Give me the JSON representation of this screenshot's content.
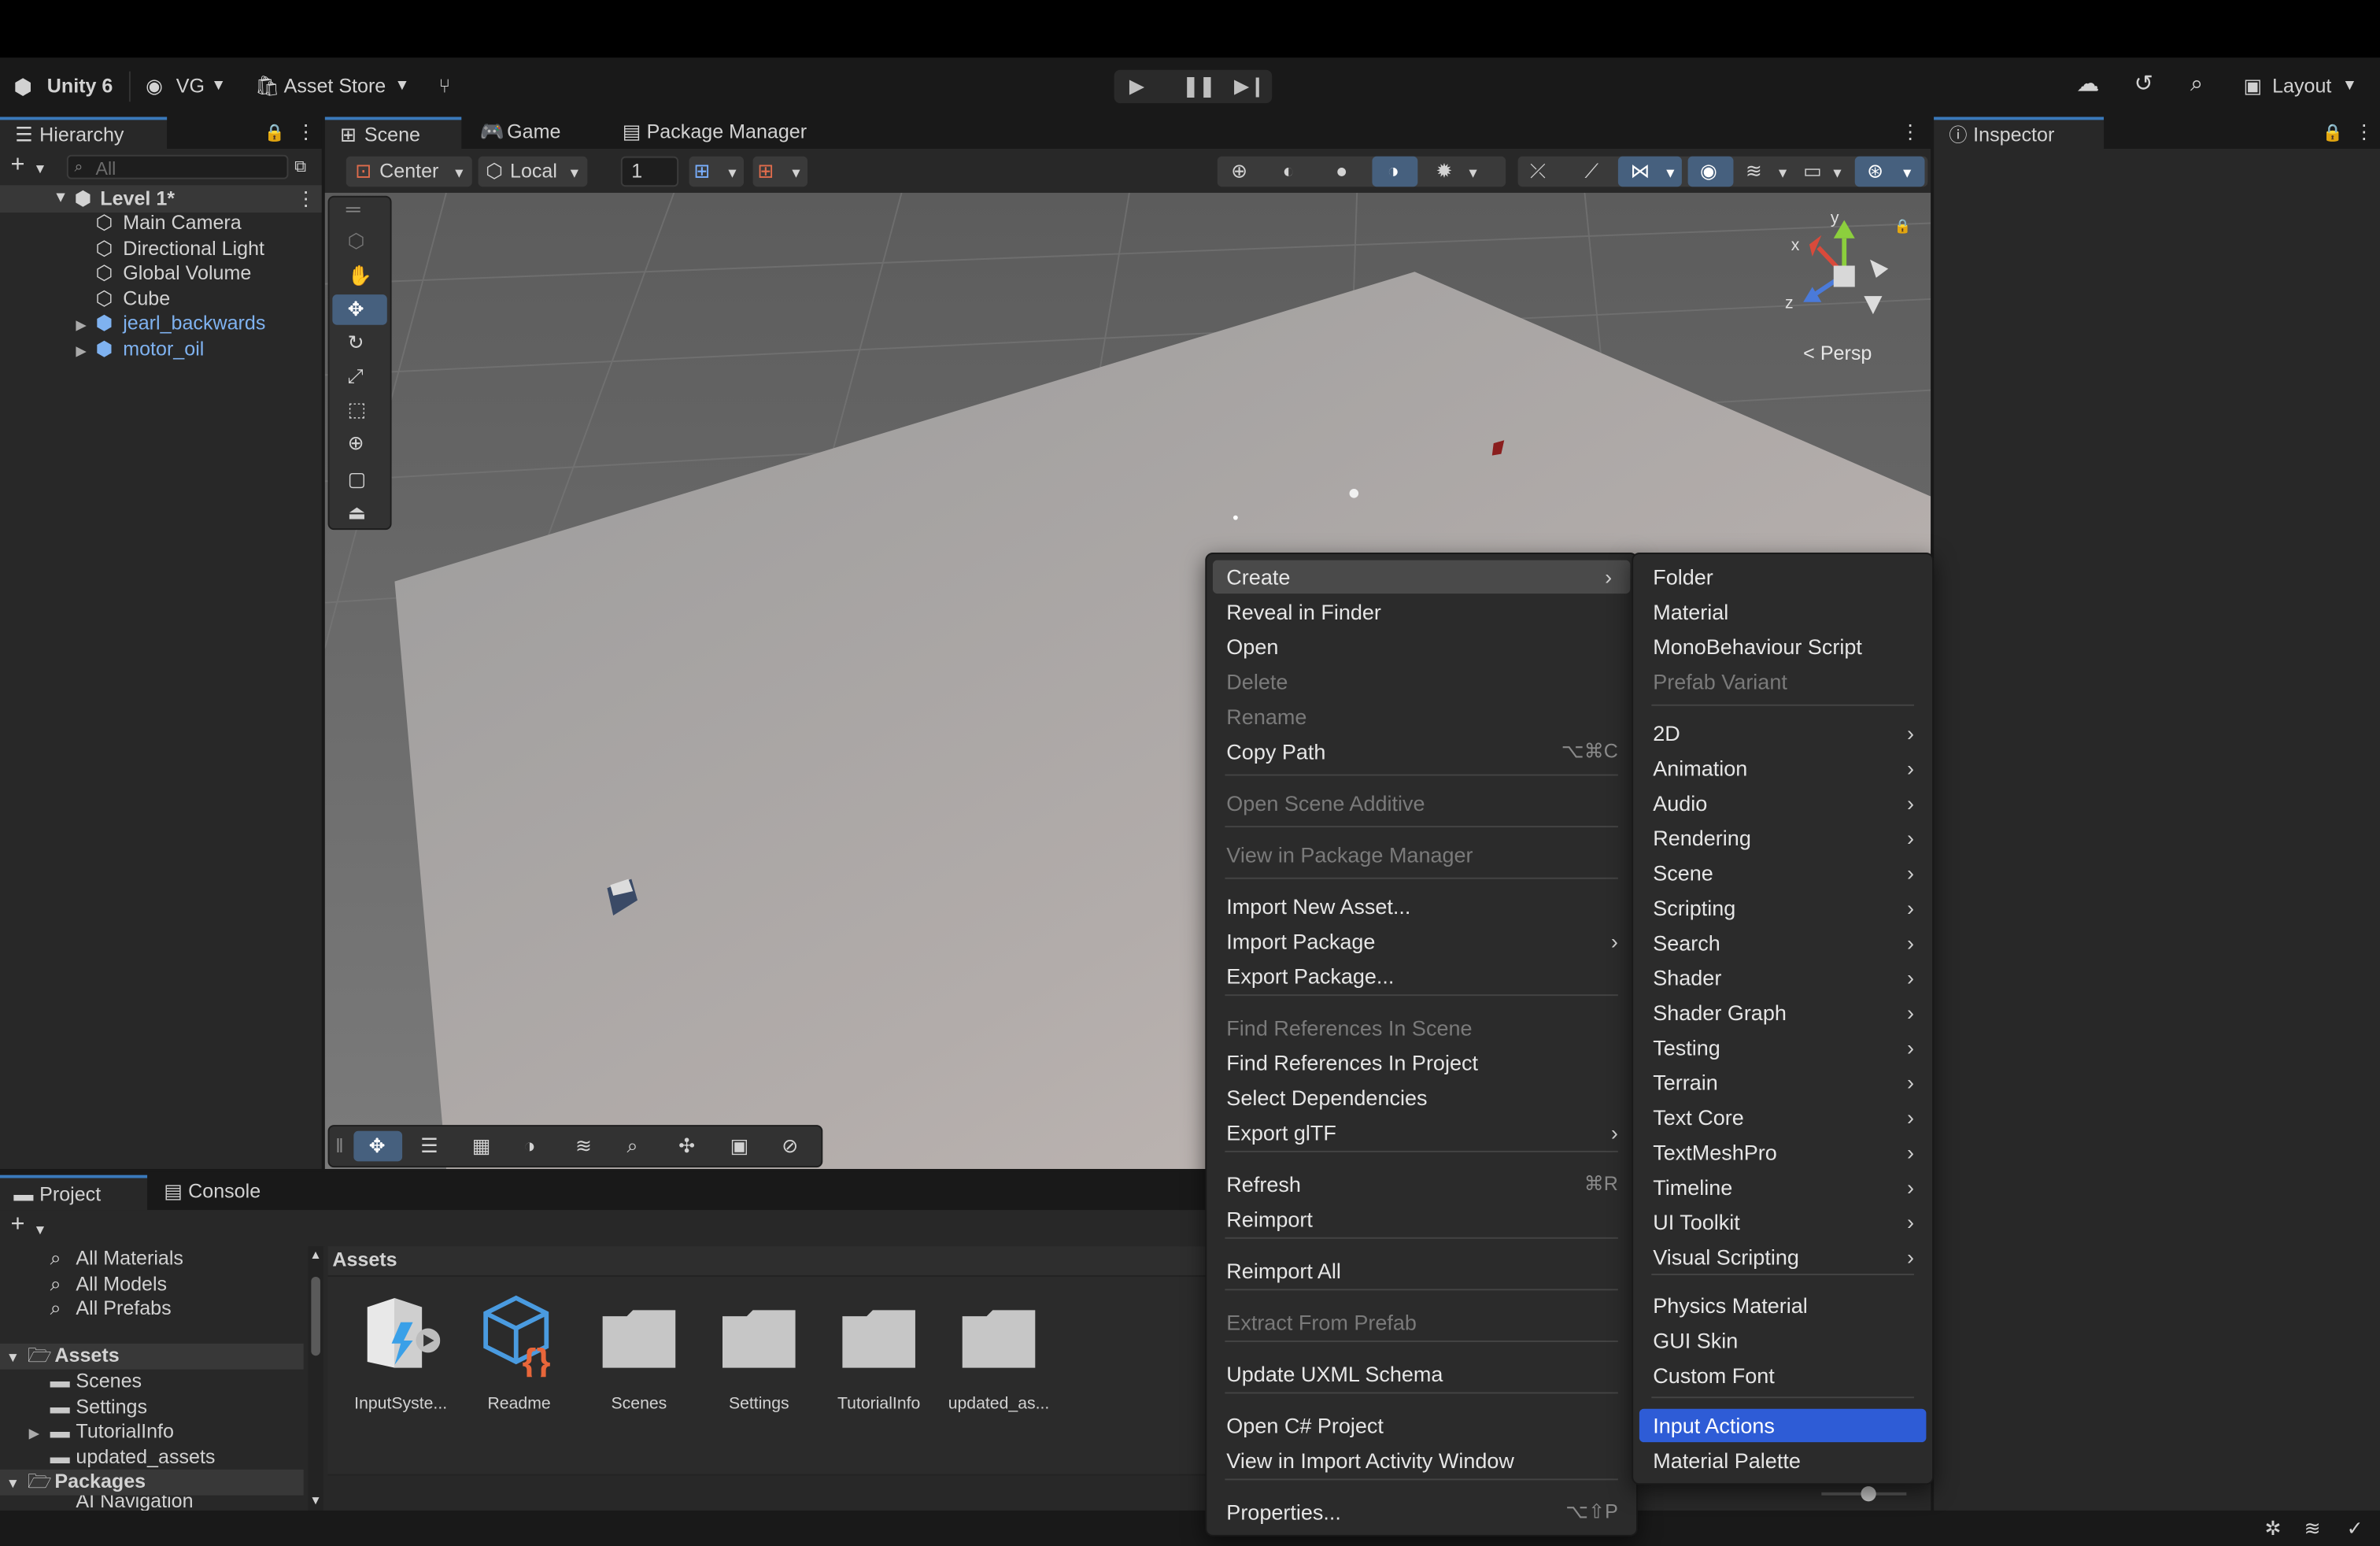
{
  "toolbar": {
    "app_name": "Unity 6",
    "account": "VG",
    "asset_store": "Asset Store",
    "layout": "Layout"
  },
  "tabs": {
    "hierarchy": "Hierarchy",
    "scene": "Scene",
    "game": "Game",
    "package_manager": "Package Manager",
    "inspector": "Inspector",
    "project": "Project",
    "console": "Console"
  },
  "hierarchy": {
    "search_placeholder": "All",
    "scene_name": "Level 1*",
    "items": [
      "Main Camera",
      "Directional Light",
      "Global Volume",
      "Cube"
    ],
    "prefabs": [
      "jearl_backwards",
      "motor_oil"
    ]
  },
  "scene_toolbar": {
    "pivot": "Center",
    "space": "Local",
    "increment": "1"
  },
  "scene_view": {
    "projection": "Persp",
    "axis_x": "x",
    "axis_y": "y",
    "axis_z": "z"
  },
  "project": {
    "favorites": [
      "All Materials",
      "All Models",
      "All Prefabs"
    ],
    "assets_root": "Assets",
    "asset_folders": [
      "Scenes",
      "Settings",
      "TutorialInfo",
      "updated_assets"
    ],
    "packages_root": "Packages",
    "packages_first": "AI Navigation",
    "breadcrumb": "Assets",
    "grid_items": [
      "InputSyste...",
      "Readme",
      "Scenes",
      "Settings",
      "TutorialInfo",
      "updated_as..."
    ]
  },
  "context_menu": {
    "items": [
      {
        "label": "Create",
        "arrow": "›",
        "highlight": true
      },
      {
        "label": "Reveal in Finder"
      },
      {
        "label": "Open"
      },
      {
        "label": "Delete",
        "disabled": true
      },
      {
        "label": "Rename",
        "disabled": true
      },
      {
        "label": "Copy Path",
        "shortcut": "⌥⌘C"
      },
      {
        "label": "Open Scene Additive",
        "disabled": true
      },
      {
        "label": "View in Package Manager",
        "disabled": true
      },
      {
        "label": "Import New Asset..."
      },
      {
        "label": "Import Package",
        "arrow": "›"
      },
      {
        "label": "Export Package..."
      },
      {
        "label": "Find References In Scene",
        "disabled": true
      },
      {
        "label": "Find References In Project"
      },
      {
        "label": "Select Dependencies"
      },
      {
        "label": "Export glTF",
        "arrow": "›"
      },
      {
        "label": "Refresh",
        "shortcut": "⌘R"
      },
      {
        "label": "Reimport"
      },
      {
        "label": "Reimport All"
      },
      {
        "label": "Extract From Prefab",
        "disabled": true
      },
      {
        "label": "Update UXML Schema"
      },
      {
        "label": "Open C# Project"
      },
      {
        "label": "View in Import Activity Window"
      },
      {
        "label": "Properties...",
        "shortcut": "⌥⇧P"
      }
    ]
  },
  "create_submenu": {
    "items": [
      {
        "label": "Folder"
      },
      {
        "label": "Material"
      },
      {
        "label": "MonoBehaviour Script"
      },
      {
        "label": "Prefab Variant",
        "disabled": true
      },
      {
        "label": "2D",
        "arrow": "›"
      },
      {
        "label": "Animation",
        "arrow": "›"
      },
      {
        "label": "Audio",
        "arrow": "›"
      },
      {
        "label": "Rendering",
        "arrow": "›"
      },
      {
        "label": "Scene",
        "arrow": "›"
      },
      {
        "label": "Scripting",
        "arrow": "›"
      },
      {
        "label": "Search",
        "arrow": "›"
      },
      {
        "label": "Shader",
        "arrow": "›"
      },
      {
        "label": "Shader Graph",
        "arrow": "›"
      },
      {
        "label": "Testing",
        "arrow": "›"
      },
      {
        "label": "Terrain",
        "arrow": "›"
      },
      {
        "label": "Text Core",
        "arrow": "›"
      },
      {
        "label": "TextMeshPro",
        "arrow": "›"
      },
      {
        "label": "Timeline",
        "arrow": "›"
      },
      {
        "label": "UI Toolkit",
        "arrow": "›"
      },
      {
        "label": "Visual Scripting",
        "arrow": "›"
      },
      {
        "label": "Physics Material"
      },
      {
        "label": "GUI Skin"
      },
      {
        "label": "Custom Font"
      },
      {
        "label": "Input Actions",
        "selected": true
      },
      {
        "label": "Material Palette"
      }
    ]
  },
  "colors": {
    "selection": "#2e5cd6",
    "prefab_text": "#7fb2f0",
    "panel": "#282828",
    "scene_bg": "#6f6f6f"
  }
}
